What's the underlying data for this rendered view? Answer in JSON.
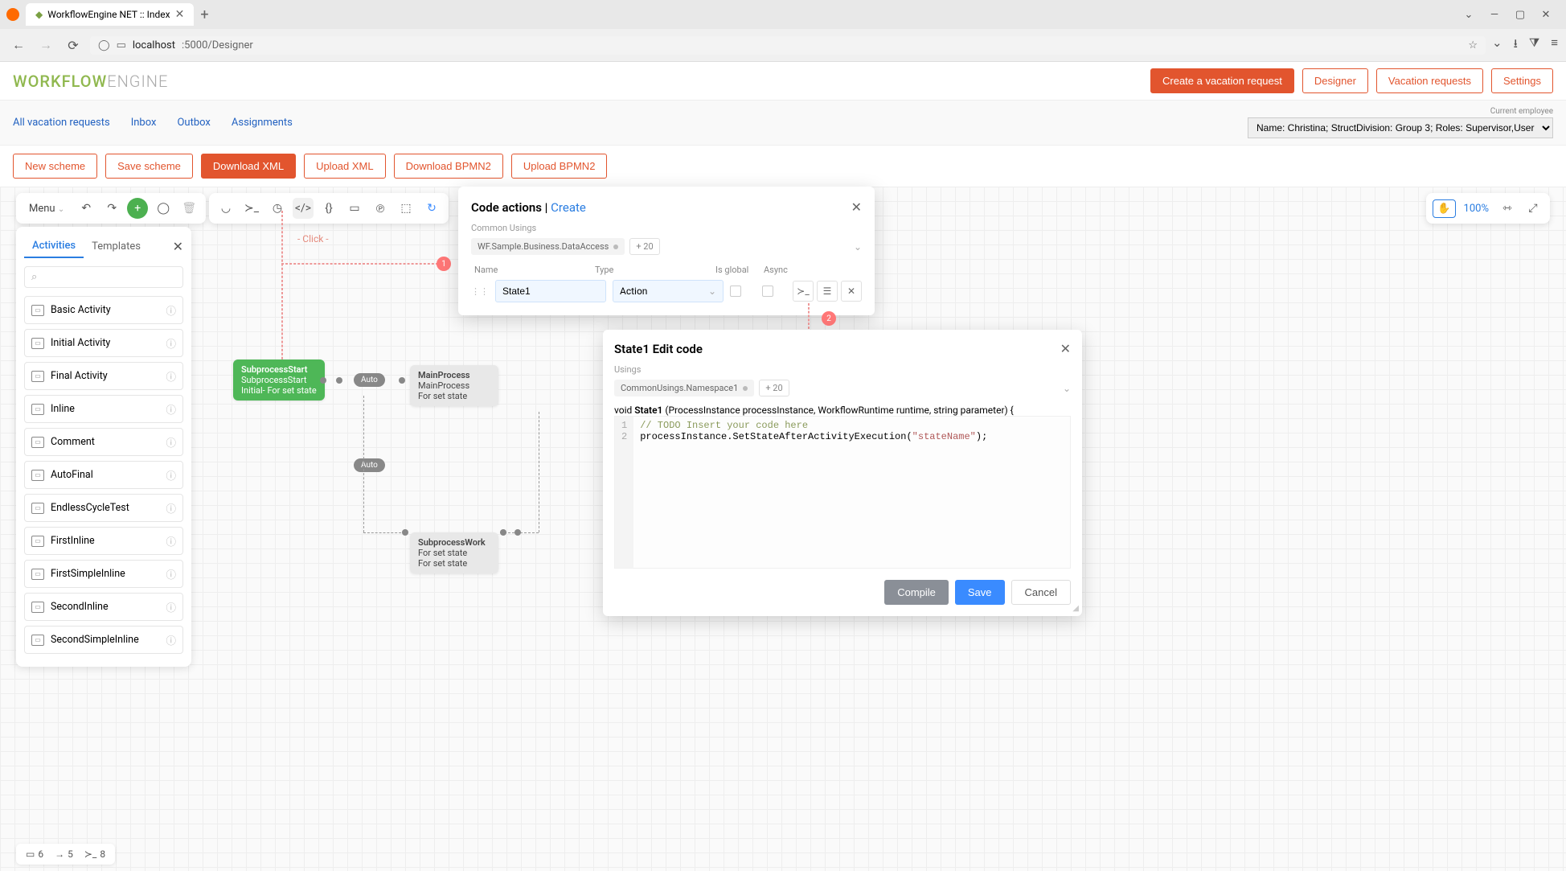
{
  "browser": {
    "tab_title": "WorkflowEngine NET :: Index",
    "url_host": "localhost",
    "url_path": ":5000/Designer"
  },
  "header": {
    "logo_a": "WORKFLOW",
    "logo_b": "ENGINE",
    "btn_create": "Create a vacation request",
    "btn_designer": "Designer",
    "btn_vacation": "Vacation requests",
    "btn_settings": "Settings"
  },
  "nav": {
    "all": "All vacation requests",
    "inbox": "Inbox",
    "outbox": "Outbox",
    "assignments": "Assignments",
    "employee_lbl": "Current employee",
    "employee_val": "Name: Christina; StructDivision: Group 3; Roles: Supervisor,User"
  },
  "scheme": {
    "new": "New scheme",
    "save": "Save scheme",
    "dlxml": "Download XML",
    "upxml": "Upload XML",
    "dlbpmn": "Download BPMN2",
    "upbpmn": "Upload BPMN2"
  },
  "toolbar": {
    "menu": "Menu",
    "zoom": "100%"
  },
  "sidebar": {
    "tab_activities": "Activities",
    "tab_templates": "Templates",
    "items": [
      "Basic Activity",
      "Initial Activity",
      "Final Activity",
      "Inline",
      "Comment",
      "AutoFinal",
      "EndlessCycleTest",
      "FirstInline",
      "FirstSimpleInline",
      "SecondInline",
      "SecondSimpleInline"
    ]
  },
  "status": {
    "a": "6",
    "b": "5",
    "c": "8"
  },
  "canvas": {
    "click": "- Click -",
    "start": {
      "t": "SubprocessStart",
      "s": "SubprocessStart",
      "d": "Initial- For set state"
    },
    "main": {
      "t": "MainProcess",
      "s": "MainProcess",
      "d": "For set state"
    },
    "work": {
      "t": "SubprocessWork",
      "s": "SubprocessWork",
      "d": "For set state"
    },
    "auto": "Auto"
  },
  "code_actions": {
    "title": "Code actions",
    "sep": " | ",
    "create": "Create",
    "common_usings": "Common Usings",
    "tag": "WF.Sample.Business.DataAccess",
    "more": "+ 20",
    "hdr_name": "Name",
    "hdr_type": "Type",
    "hdr_global": "Is global",
    "hdr_async": "Async",
    "row_name": "State1",
    "row_type": "Action"
  },
  "edit_code": {
    "title": "State1 Edit code",
    "usings": "Usings",
    "tag": "CommonUsings.Namespace1",
    "more": "+ 20",
    "sig_pre": "void ",
    "sig_name": "State1",
    "sig_post": " (ProcessInstance processInstance, WorkflowRuntime runtime, string parameter) {",
    "line1": "// TODO Insert your code here",
    "line2a": "processInstance.SetStateAfterActivityExecution(",
    "line2b": "\"stateName\"",
    "line2c": ");",
    "btn_compile": "Compile",
    "btn_save": "Save",
    "btn_cancel": "Cancel"
  }
}
